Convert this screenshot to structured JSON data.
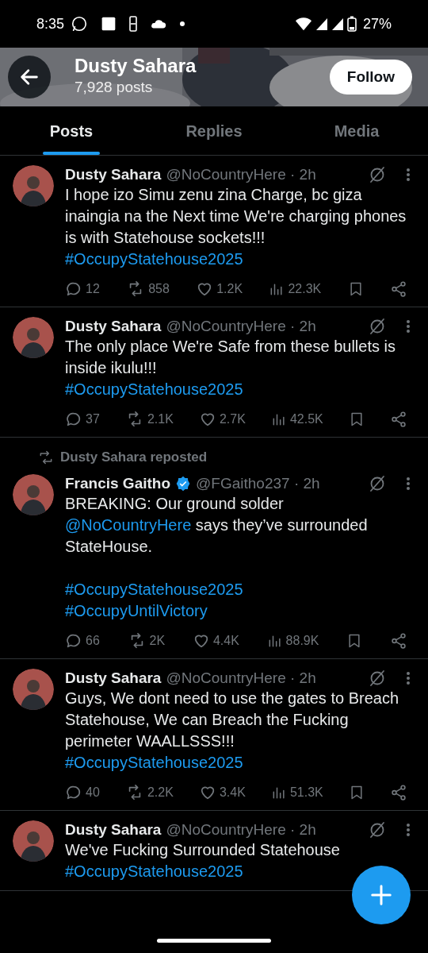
{
  "status_bar": {
    "time": "8:35",
    "battery": "27%"
  },
  "header": {
    "name": "Dusty Sahara",
    "posts": "7,928 posts",
    "follow": "Follow"
  },
  "tabs": [
    {
      "label": "Posts",
      "selected": true
    },
    {
      "label": "Replies",
      "selected": false
    },
    {
      "label": "Media",
      "selected": false
    }
  ],
  "tweets": [
    {
      "author": "Dusty Sahara",
      "verified": false,
      "meta": "@NoCountryHere · 2h",
      "parts": [
        {
          "kind": "text",
          "text": "I hope izo Simu zenu zina Charge, bc giza inaingia na the Next time We're charging phones is with Statehouse sockets!!!"
        },
        {
          "kind": "break"
        },
        {
          "kind": "hashtag",
          "text": "#OccupyStatehouse2025"
        }
      ],
      "stats": {
        "replies": "12",
        "reposts": "858",
        "likes": "1.2K",
        "views": "22.3K",
        "liked": false
      }
    },
    {
      "author": "Dusty Sahara",
      "verified": false,
      "meta": "@NoCountryHere · 2h",
      "parts": [
        {
          "kind": "text",
          "text": "The only place We're Safe from these bullets is inside ikulu!!!"
        },
        {
          "kind": "break"
        },
        {
          "kind": "hashtag",
          "text": "#OccupyStatehouse2025"
        }
      ],
      "stats": {
        "replies": "37",
        "reposts": "2.1K",
        "likes": "2.7K",
        "views": "42.5K",
        "liked": false
      }
    },
    {
      "repost_label": "Dusty Sahara reposted",
      "author": "Francis Gaitho",
      "verified": true,
      "meta": "@FGaitho237 · 2h",
      "parts": [
        {
          "kind": "text",
          "text": "BREAKING: Our ground solder "
        },
        {
          "kind": "mention",
          "text": "@NoCountryHere"
        },
        {
          "kind": "text",
          "text": " says they’ve surrounded StateHouse."
        },
        {
          "kind": "break"
        },
        {
          "kind": "break"
        },
        {
          "kind": "hashtag",
          "text": "#OccupyStatehouse2025"
        },
        {
          "kind": "break"
        },
        {
          "kind": "hashtag",
          "text": "#OccupyUntilVictory"
        }
      ],
      "stats": {
        "replies": "66",
        "reposts": "2K",
        "likes": "4.4K",
        "views": "88.9K",
        "liked": false
      }
    },
    {
      "author": "Dusty Sahara",
      "verified": false,
      "meta": "@NoCountryHere · 2h",
      "parts": [
        {
          "kind": "text",
          "text": "Guys, We dont need to use the gates to Breach Statehouse, We can Breach the Fucking perimeter WAALLSSS!!!"
        },
        {
          "kind": "break"
        },
        {
          "kind": "hashtag",
          "text": "#OccupyStatehouse2025"
        }
      ],
      "stats": {
        "replies": "40",
        "reposts": "2.2K",
        "likes": "3.4K",
        "views": "51.3K",
        "liked": false
      }
    },
    {
      "author": "Dusty Sahara",
      "verified": false,
      "meta": "@NoCountryHere · 2h",
      "parts": [
        {
          "kind": "text",
          "text": "We've Fucking Surrounded Statehouse"
        },
        {
          "kind": "break"
        },
        {
          "kind": "hashtag",
          "text": "#OccupyStatehouse2025"
        }
      ]
    }
  ]
}
